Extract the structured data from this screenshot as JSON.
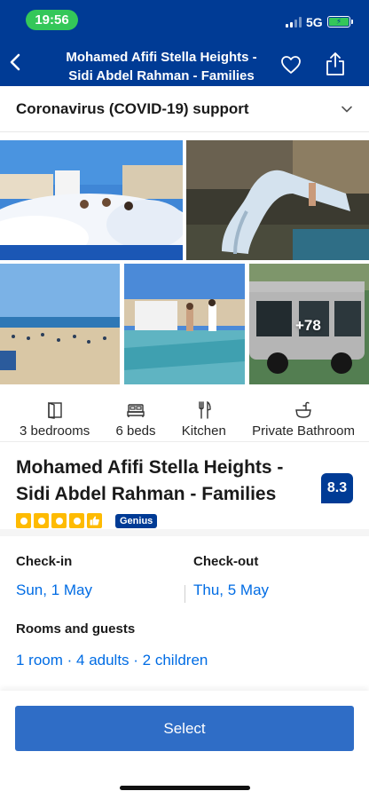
{
  "status_bar": {
    "time": "19:56",
    "network": "5G",
    "battery_charging": true,
    "signal_bars": 2
  },
  "header": {
    "title": "Mohamed Afifi Stella Heights - Sidi Abdel Rahman - Families",
    "background_color": "#003b95"
  },
  "covid": {
    "label": "Coronavirus (COVID-19) support"
  },
  "gallery": {
    "more_count": "+78"
  },
  "facilities": [
    {
      "icon": "bedroom-icon",
      "label": "3 bedrooms"
    },
    {
      "icon": "bed-icon",
      "label": "6 beds"
    },
    {
      "icon": "fork-knife-icon",
      "label": "Kitchen"
    },
    {
      "icon": "bathtub-icon",
      "label": "Private Bathroom"
    }
  ],
  "property": {
    "name": "Mohamed Afifi Stella Heights - Sidi Abdel Rahman - Families",
    "score": "8.3",
    "rating_squares": 4,
    "genius_label": "Genius",
    "accent_color": "#febb02"
  },
  "booking": {
    "checkin_label": "Check-in",
    "checkin_value": "Sun, 1 May",
    "checkout_label": "Check-out",
    "checkout_value": "Thu, 5 May",
    "rooms_label": "Rooms and guests",
    "rooms_value": "1 room · 4 adults · 2 children",
    "link_color": "#006ce4"
  },
  "cta": {
    "select_label": "Select",
    "button_color": "#2f6dc6"
  }
}
